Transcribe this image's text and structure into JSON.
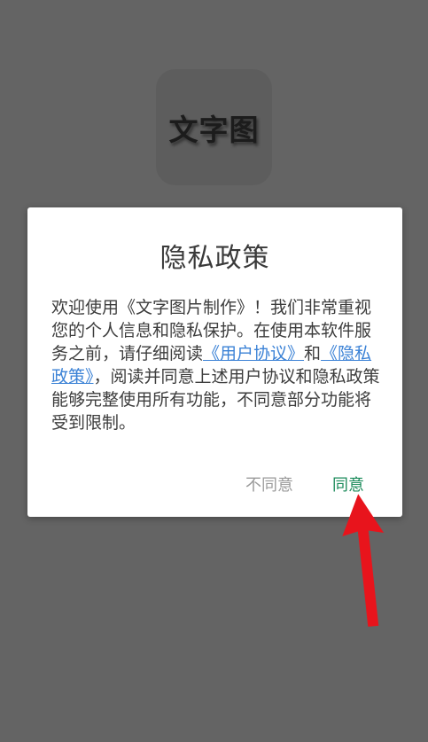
{
  "app": {
    "logo_text": "文字图"
  },
  "dialog": {
    "title": "隐私政策",
    "body_part1": "欢迎使用《文字图片制作》！我们非常重视您的个人信息和隐私保护。在使用本软件服务之前，请仔细阅读",
    "user_agreement_link": "《用户协议》",
    "body_and": "和",
    "privacy_policy_link": "《隐私政策》",
    "body_part2": "，阅读并同意上述用户协议和隐私政策能够完整使用所有功能，不同意部分功能将受到限制。",
    "disagree_label": "不同意",
    "agree_label": "同意"
  },
  "colors": {
    "overlay": "#646464",
    "agree": "#1a8a5a",
    "disagree": "#9a9a9a",
    "link": "#3b82d6",
    "annotation_arrow": "#e8141c"
  },
  "annotation": {
    "arrow_target": "agree-button"
  }
}
